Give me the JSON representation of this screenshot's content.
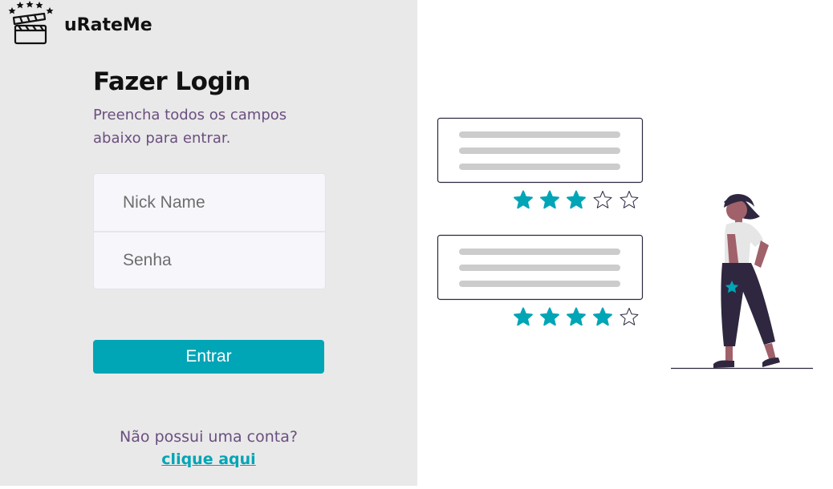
{
  "brand": {
    "name": "uRateMe"
  },
  "login": {
    "title": "Fazer Login",
    "subtitle": "Preencha todos os campos abaixo para entrar.",
    "nick_placeholder": "Nick Name",
    "password_placeholder": "Senha",
    "submit_label": "Entrar",
    "no_account_text": "Não possui uma conta?",
    "signup_link": "clique aqui"
  },
  "illustration": {
    "review_ratings": [
      3,
      4
    ],
    "max_rating": 5
  },
  "colors": {
    "accent": "#00a5b6",
    "subtitle": "#6b4f7f",
    "left_panel_bg": "#e9e9e9",
    "dark_figure": "#2f2740",
    "skin": "#a0616a"
  }
}
